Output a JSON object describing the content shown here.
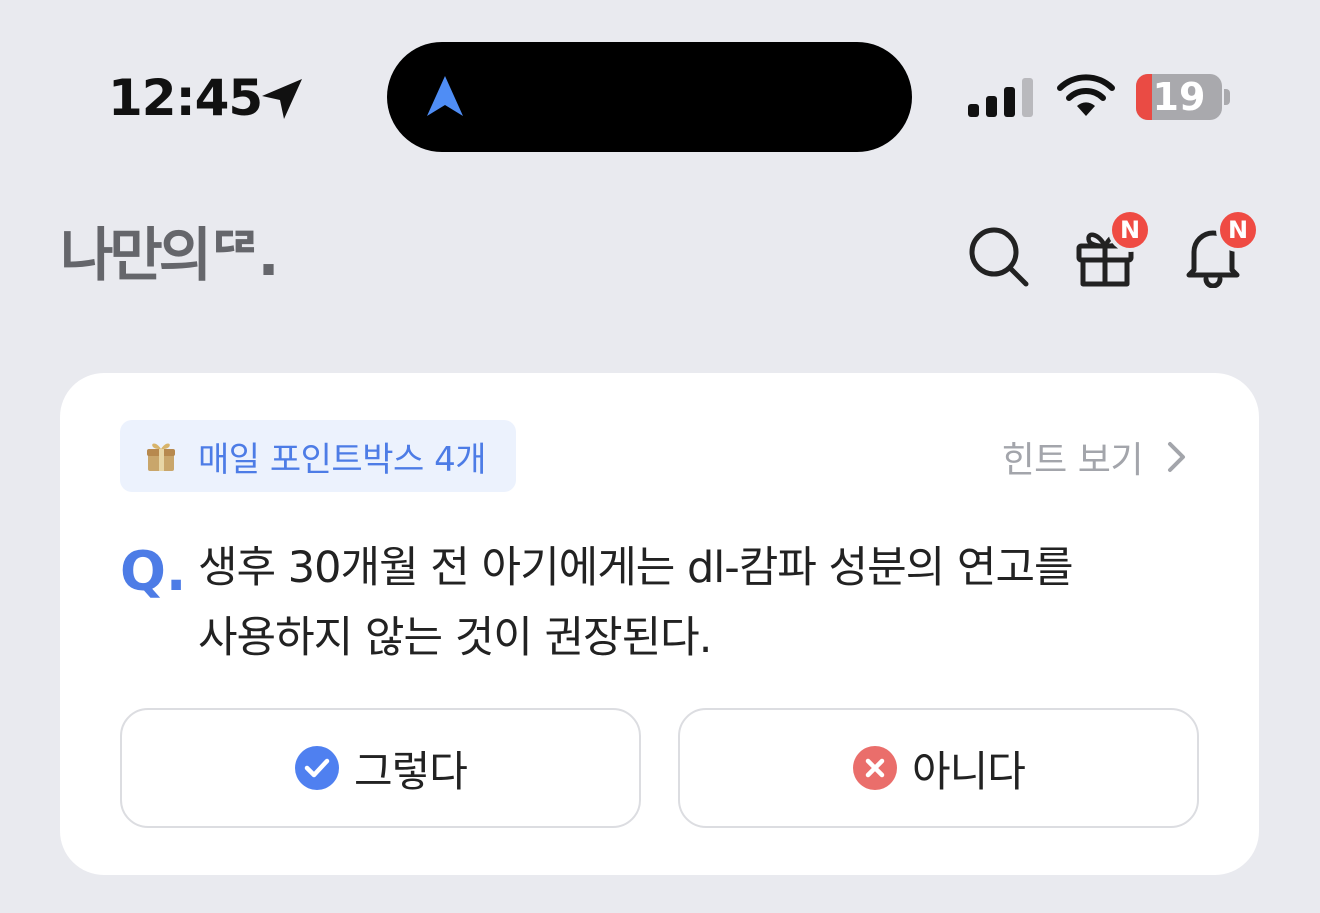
{
  "status_bar": {
    "time": "12:45",
    "battery_level": "19",
    "battery_fraction": 0.19,
    "icons": [
      "location-arrow-icon",
      "navigation-icon",
      "cellular-signal-icon",
      "wifi-icon",
      "battery-icon"
    ]
  },
  "header": {
    "logo_text": "나만의ᄃᄅ.",
    "icons": [
      "search-icon",
      "gift-icon",
      "bell-icon"
    ],
    "gift_badge": "N",
    "bell_badge": "N"
  },
  "quiz": {
    "chip_icon": "gift-box-icon",
    "chip_label": "매일 포인트박스 4개",
    "hint_label": "힌트 보기",
    "q_label": "Q.",
    "question": "생후 30개월 전 아기에게는 dl-캄파 성분의 연고를 사용하지 않는 것이 권장된다.",
    "answers": [
      {
        "label": "그렇다",
        "icon": "check-circle-icon"
      },
      {
        "label": "아니다",
        "icon": "x-circle-icon"
      }
    ]
  },
  "colors": {
    "background": "#e9eaef",
    "accent_blue": "#4d7ce6",
    "badge_red": "#ef4b43",
    "no_red": "#ea6e6b",
    "yes_blue": "#4f80f0"
  }
}
